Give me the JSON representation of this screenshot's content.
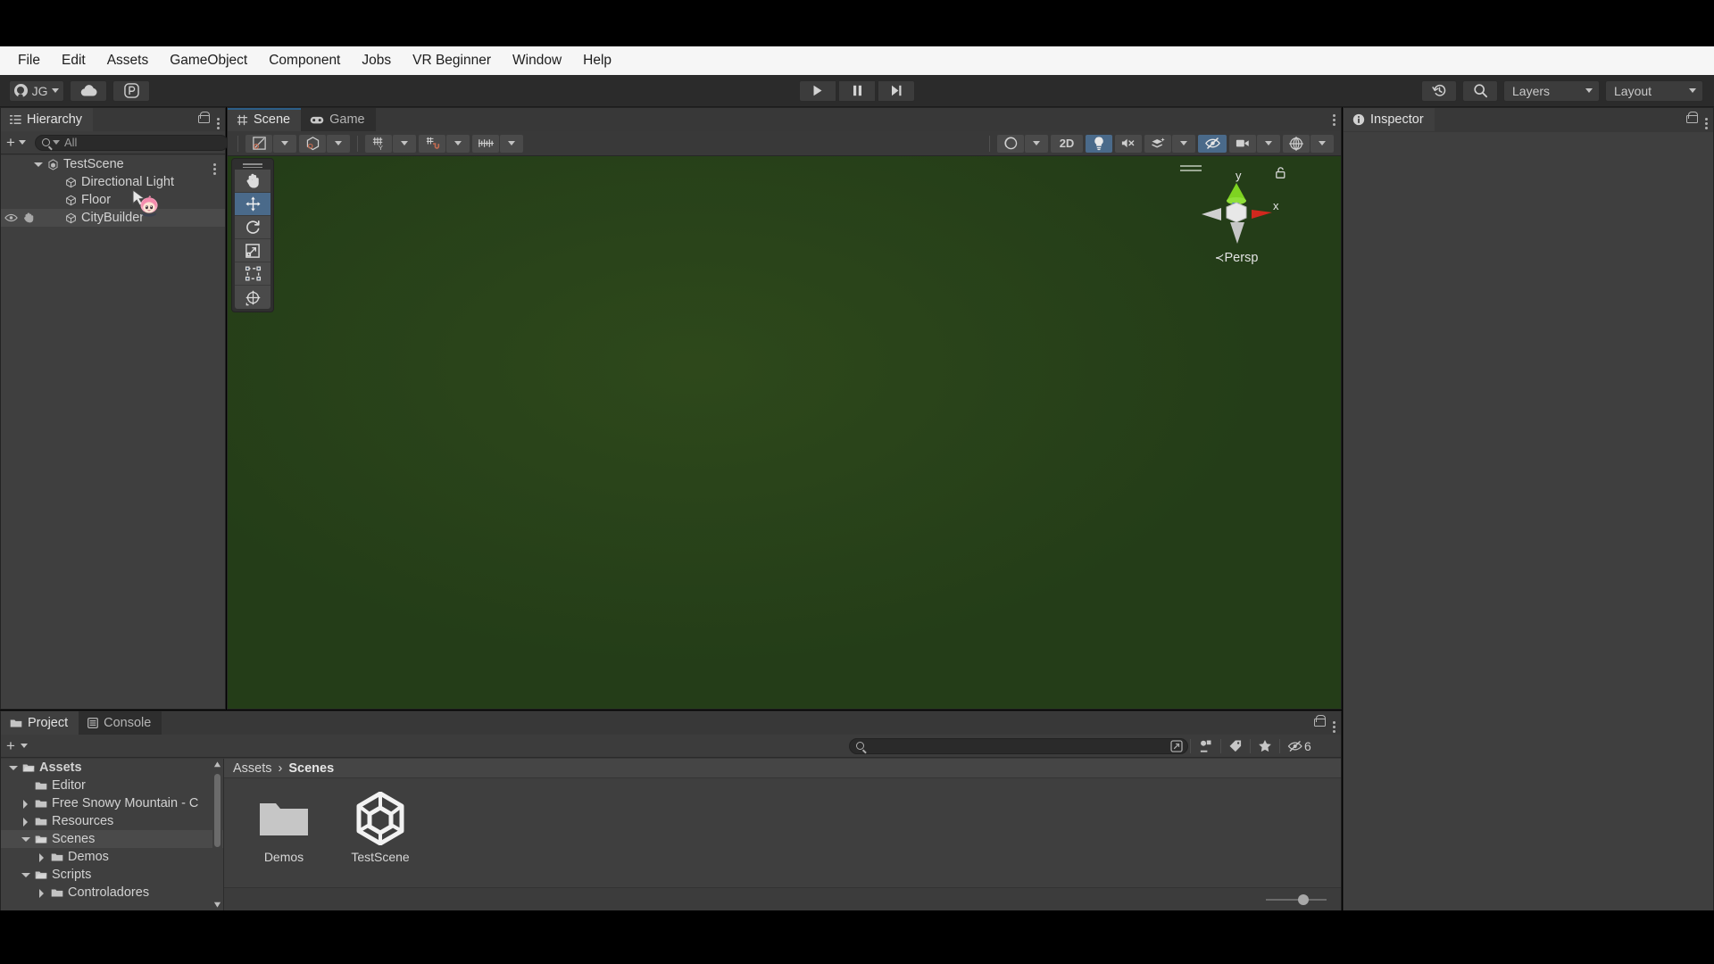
{
  "app": {
    "title": "Unity Editor"
  },
  "menubar": {
    "items": [
      {
        "label": "File"
      },
      {
        "label": "Edit"
      },
      {
        "label": "Assets"
      },
      {
        "label": "GameObject"
      },
      {
        "label": "Component"
      },
      {
        "label": "Jobs"
      },
      {
        "label": "VR Beginner"
      },
      {
        "label": "Window"
      },
      {
        "label": "Help"
      }
    ]
  },
  "toolbar": {
    "account_label": "JG",
    "account_icon": "user-avatar-icon",
    "cloud_icon": "cloud-icon",
    "plastic_icon": "plastic-scm-icon",
    "play_icon": "play-icon",
    "pause_icon": "pause-icon",
    "step_icon": "step-forward-icon",
    "history_icon": "undo-history-icon",
    "search_icon": "search-icon",
    "layers_label": "Layers",
    "layout_label": "Layout"
  },
  "hierarchy": {
    "tab_label": "Hierarchy",
    "tab_icon": "hierarchy-icon",
    "lock_icon": "lock-icon",
    "menu_icon": "kebab-menu-icon",
    "add_icon": "plus-icon",
    "search_placeholder": "All",
    "search_value": "",
    "search_icon": "search-icon",
    "expand_icon": "expand-search-icon",
    "rows": [
      {
        "label": "TestScene",
        "icon": "unity-scene-icon",
        "indent": 0,
        "expanded": true,
        "selected": false,
        "has_menu": true
      },
      {
        "label": "Directional Light",
        "icon": "gameobject-cube-icon",
        "indent": 1,
        "expanded": null,
        "selected": false,
        "has_menu": false
      },
      {
        "label": "Floor",
        "icon": "gameobject-cube-icon",
        "indent": 1,
        "expanded": null,
        "selected": false,
        "has_menu": false
      },
      {
        "label": "CityBuilder",
        "icon": "gameobject-cube-icon",
        "indent": 1,
        "expanded": null,
        "selected": true,
        "has_menu": false
      }
    ],
    "visibility_icon": "eye-icon",
    "pickability_icon": "hand-pointer-icon"
  },
  "scene": {
    "tabs": [
      {
        "label": "Scene",
        "icon": "scene-grid-icon",
        "active": true
      },
      {
        "label": "Game",
        "icon": "gamepad-icon",
        "active": false
      }
    ],
    "menu_icon": "kebab-menu-icon",
    "toolbar_left": [
      {
        "name": "draw-mode-dropdown",
        "icon": "draw-mode-icon",
        "has_caret": true,
        "active": false
      },
      {
        "name": "2d-3d-shape-dropdown",
        "icon": "shape-cube-icon",
        "has_caret": true,
        "active": false
      },
      {
        "name": "grid-visibility-dropdown",
        "icon": "grid-axis-icon",
        "has_caret": true,
        "active": false
      },
      {
        "name": "grid-snap-dropdown",
        "icon": "grid-snap-magnet-icon",
        "has_caret": true,
        "active": false
      },
      {
        "name": "snap-increment-dropdown",
        "icon": "snap-ruler-icon",
        "has_caret": true,
        "active": false
      }
    ],
    "toolbar_right": [
      {
        "name": "shading-mode-dropdown",
        "icon": "shaded-sphere-icon",
        "label": "",
        "has_caret": true,
        "active": false
      },
      {
        "name": "2d-toggle-button",
        "icon": "",
        "label": "2D",
        "has_caret": false,
        "active": false
      },
      {
        "name": "scene-lighting-toggle",
        "icon": "lightbulb-icon",
        "label": "",
        "has_caret": false,
        "active": true
      },
      {
        "name": "scene-audio-toggle",
        "icon": "speaker-mute-icon",
        "label": "",
        "has_caret": false,
        "active": false
      },
      {
        "name": "scene-fx-dropdown",
        "icon": "effects-layers-icon",
        "label": "",
        "has_caret": true,
        "active": false
      },
      {
        "name": "hidden-objects-toggle",
        "icon": "eye-slash-icon",
        "label": "",
        "has_caret": false,
        "active": true
      },
      {
        "name": "scene-camera-dropdown",
        "icon": "camera-icon",
        "label": "",
        "has_caret": true,
        "active": false
      },
      {
        "name": "gizmos-dropdown",
        "icon": "gizmo-globe-icon",
        "label": "",
        "has_caret": true,
        "active": false
      }
    ],
    "tools": [
      {
        "name": "hand-tool",
        "icon": "hand-icon",
        "active": false
      },
      {
        "name": "move-tool",
        "icon": "move-arrows-icon",
        "active": true
      },
      {
        "name": "rotate-tool",
        "icon": "rotate-icon",
        "active": false
      },
      {
        "name": "scale-tool",
        "icon": "scale-icon",
        "active": false
      },
      {
        "name": "rect-transform-tool",
        "icon": "rect-transform-icon",
        "active": false
      },
      {
        "name": "transform-tool",
        "icon": "transform-combo-icon",
        "active": false
      }
    ],
    "gizmo": {
      "axis_y_label": "y",
      "axis_x_label": "x",
      "projection_label": "Persp",
      "lock_icon": "gizmo-lock-icon"
    },
    "viewport_color": "#243d18"
  },
  "project": {
    "tabs": [
      {
        "label": "Project",
        "icon": "folder-icon",
        "active": true
      },
      {
        "label": "Console",
        "icon": "console-icon",
        "active": false
      }
    ],
    "lock_icon": "lock-icon",
    "menu_icon": "kebab-menu-icon",
    "add_icon": "plus-icon",
    "search_placeholder": "",
    "search_value": "",
    "search_icon": "search-icon",
    "expand_icon": "expand-search-icon",
    "filters": [
      {
        "name": "filter-by-type-button",
        "icon": "object-filter-icon",
        "label": ""
      },
      {
        "name": "filter-by-label-button",
        "icon": "tag-icon",
        "label": ""
      },
      {
        "name": "filter-favorites-button",
        "icon": "star-icon",
        "label": ""
      },
      {
        "name": "hidden-packages-button",
        "icon": "eye-slash-icon",
        "label": "6"
      }
    ],
    "tree": [
      {
        "label": "Assets",
        "indent": 0,
        "expanded": true,
        "selected": false,
        "bold": true,
        "open_folder": true
      },
      {
        "label": "Editor",
        "indent": 1,
        "expanded": null,
        "selected": false,
        "bold": false,
        "open_folder": false
      },
      {
        "label": "Free Snowy Mountain - C",
        "indent": 1,
        "expanded": false,
        "selected": false,
        "bold": false,
        "open_folder": false
      },
      {
        "label": "Resources",
        "indent": 1,
        "expanded": false,
        "selected": false,
        "bold": false,
        "open_folder": false
      },
      {
        "label": "Scenes",
        "indent": 1,
        "expanded": true,
        "selected": true,
        "bold": false,
        "open_folder": true
      },
      {
        "label": "Demos",
        "indent": 2,
        "expanded": false,
        "selected": false,
        "bold": false,
        "open_folder": false
      },
      {
        "label": "Scripts",
        "indent": 1,
        "expanded": true,
        "selected": false,
        "bold": false,
        "open_folder": true
      },
      {
        "label": "Controladores",
        "indent": 2,
        "expanded": false,
        "selected": false,
        "bold": false,
        "open_folder": false
      }
    ],
    "breadcrumb": [
      "Assets",
      "Scenes"
    ],
    "breadcrumb_separator": "›",
    "assets": [
      {
        "label": "Demos",
        "icon": "folder-icon"
      },
      {
        "label": "TestScene",
        "icon": "unity-scene-asset-icon"
      }
    ],
    "zoom_slider_name": "thumbnail-size-slider"
  },
  "inspector": {
    "tab_label": "Inspector",
    "tab_icon": "info-circle-icon",
    "lock_icon": "lock-icon",
    "menu_icon": "kebab-menu-icon"
  },
  "cursor": {
    "name": "anime-custom-cursor"
  },
  "colors": {
    "accent_blue": "#4a6a8a",
    "tab_accent": "#2c5d87",
    "panel_bg": "#3f3f3f",
    "chrome_bg": "#383838",
    "toolbar_bg": "#2b2b2b",
    "viewport_green": "#243d18",
    "menubar_bg": "#f6f6f6"
  }
}
